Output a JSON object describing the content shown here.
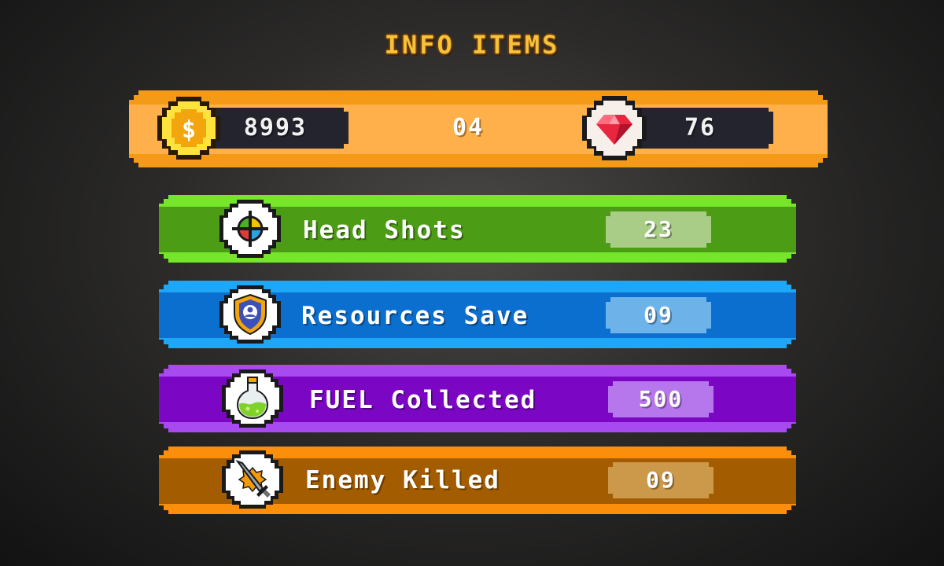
{
  "screen": {
    "title": "INFO ITEMS"
  },
  "top_bar": {
    "coins": "8993",
    "level": "04",
    "gems": "76",
    "colors": {
      "outer": "#f59a16",
      "inner": "#ffb04a",
      "slot": "#24242f",
      "coin": "#ffd21a",
      "gem": "#e8263f"
    }
  },
  "stats": [
    {
      "label": "Head Shots",
      "value": "23",
      "icon": "crosshair-icon",
      "colors": {
        "outer": "#76e62b",
        "inner": "#4d9c16",
        "badge": "#a9cd87"
      }
    },
    {
      "label": "Resources Save",
      "value": "09",
      "icon": "shield-user-icon",
      "colors": {
        "outer": "#1ea6f7",
        "inner": "#0b6fcf",
        "badge": "#6db3ea"
      }
    },
    {
      "label": "FUEL Collected",
      "value": "500",
      "icon": "potion-icon",
      "colors": {
        "outer": "#a74bf0",
        "inner": "#7b07c4",
        "badge": "#b777ec"
      }
    },
    {
      "label": "Enemy Killed",
      "value": "09",
      "icon": "sword-icon",
      "colors": {
        "outer": "#fb8f0b",
        "inner": "#a35c00",
        "badge": "#cc9849"
      }
    }
  ]
}
